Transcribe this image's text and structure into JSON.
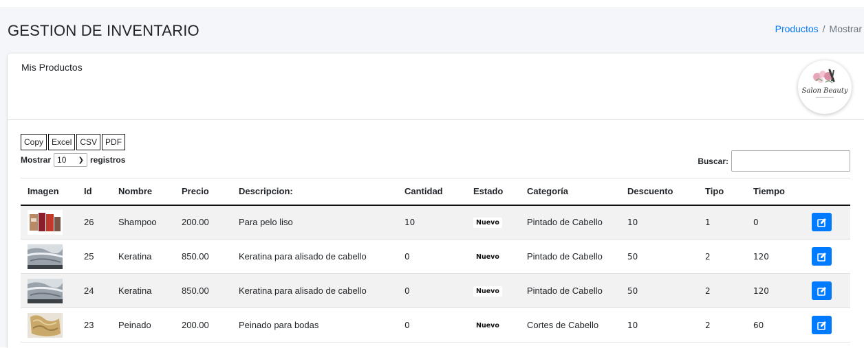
{
  "header": {
    "title": "GESTION DE INVENTARIO",
    "breadcrumb": {
      "link": "Productos",
      "separator": "/",
      "current": "Mostrar"
    }
  },
  "card": {
    "title": "Mis Productos",
    "logo_text": "Salon Beauty"
  },
  "toolbar": {
    "buttons": [
      "Copy",
      "Excel",
      "CSV",
      "PDF"
    ],
    "length_label_before": "Mostrar",
    "length_value": "10",
    "length_label_after": "registros",
    "search_label": "Buscar:",
    "search_value": ""
  },
  "table": {
    "columns": [
      "Imagen",
      "Id",
      "Nombre",
      "Precio",
      "Descripcion:",
      "Cantidad",
      "Estado",
      "Categoría",
      "Descuento",
      "Tipo",
      "Tiempo",
      ""
    ],
    "rows": [
      {
        "image": "shampoo-bottles-photo",
        "id": "26",
        "nombre": "Shampoo",
        "precio": "200.00",
        "descripcion": "Para pelo liso",
        "cantidad": "10",
        "estado": "Nuevo",
        "categoria": "Pintado de Cabello",
        "descuento": "10",
        "tipo": "1",
        "tiempo": "0"
      },
      {
        "image": "keratin-hair-photo",
        "id": "25",
        "nombre": "Keratina",
        "precio": "850.00",
        "descripcion": "Keratina para alisado de cabello",
        "cantidad": "0",
        "estado": "Nuevo",
        "categoria": "Pintado de Cabello",
        "descuento": "50",
        "tipo": "2",
        "tiempo": "120"
      },
      {
        "image": "keratin-hair-photo",
        "id": "24",
        "nombre": "Keratina",
        "precio": "850.00",
        "descripcion": "Keratina para alisado de cabello",
        "cantidad": "0",
        "estado": "Nuevo",
        "categoria": "Pintado de Cabello",
        "descuento": "50",
        "tipo": "2",
        "tiempo": "120"
      },
      {
        "image": "wavy-hairstyle-photo",
        "id": "23",
        "nombre": "Peinado",
        "precio": "200.00",
        "descripcion": "Peinado para bodas",
        "cantidad": "0",
        "estado": "Nuevo",
        "categoria": "Cortes de Cabello",
        "descuento": "10",
        "tipo": "2",
        "tiempo": "60"
      }
    ]
  },
  "colors": {
    "accent": "#007bff",
    "page_background": "#f4f6f9",
    "striped_row": "#f2f2f2"
  },
  "icons": {
    "edit": "edit-square-icon"
  }
}
